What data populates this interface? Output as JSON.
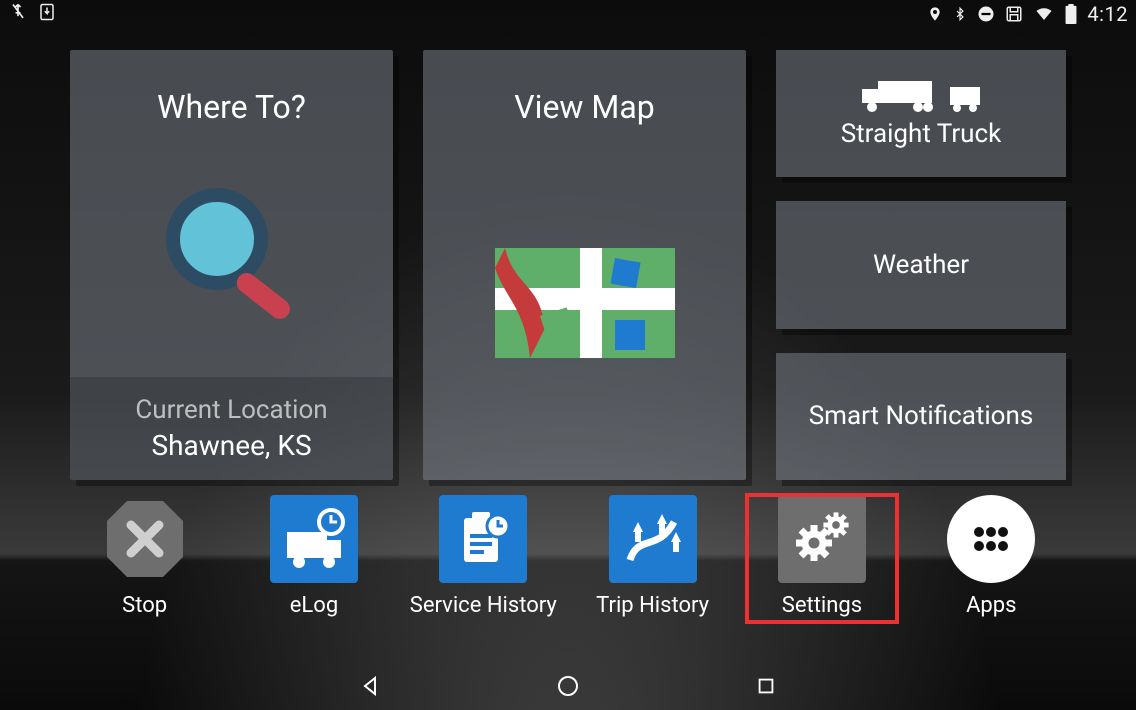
{
  "status": {
    "time": "4:12"
  },
  "tiles": {
    "where_to": {
      "title": "Where To?",
      "footer_label": "Current Location",
      "location": "Shawnee, KS"
    },
    "view_map": {
      "title": "View Map"
    },
    "side": [
      {
        "label": "Straight Truck",
        "icon": "truck"
      },
      {
        "label": "Weather",
        "icon": "none"
      },
      {
        "label": "Smart Notifications",
        "icon": "none"
      }
    ]
  },
  "dock": [
    {
      "label": "Stop",
      "icon": "stop",
      "color": "#6e6e6e"
    },
    {
      "label": "eLog",
      "icon": "elog",
      "color": "#1f7bd0"
    },
    {
      "label": "Service History",
      "icon": "service",
      "color": "#1f7bd0"
    },
    {
      "label": "Trip History",
      "icon": "trip",
      "color": "#1f7bd0"
    },
    {
      "label": "Settings",
      "icon": "settings",
      "color": "#6e6e6e",
      "highlighted": true
    },
    {
      "label": "Apps",
      "icon": "apps",
      "color": "#ffffff",
      "round": true
    }
  ]
}
